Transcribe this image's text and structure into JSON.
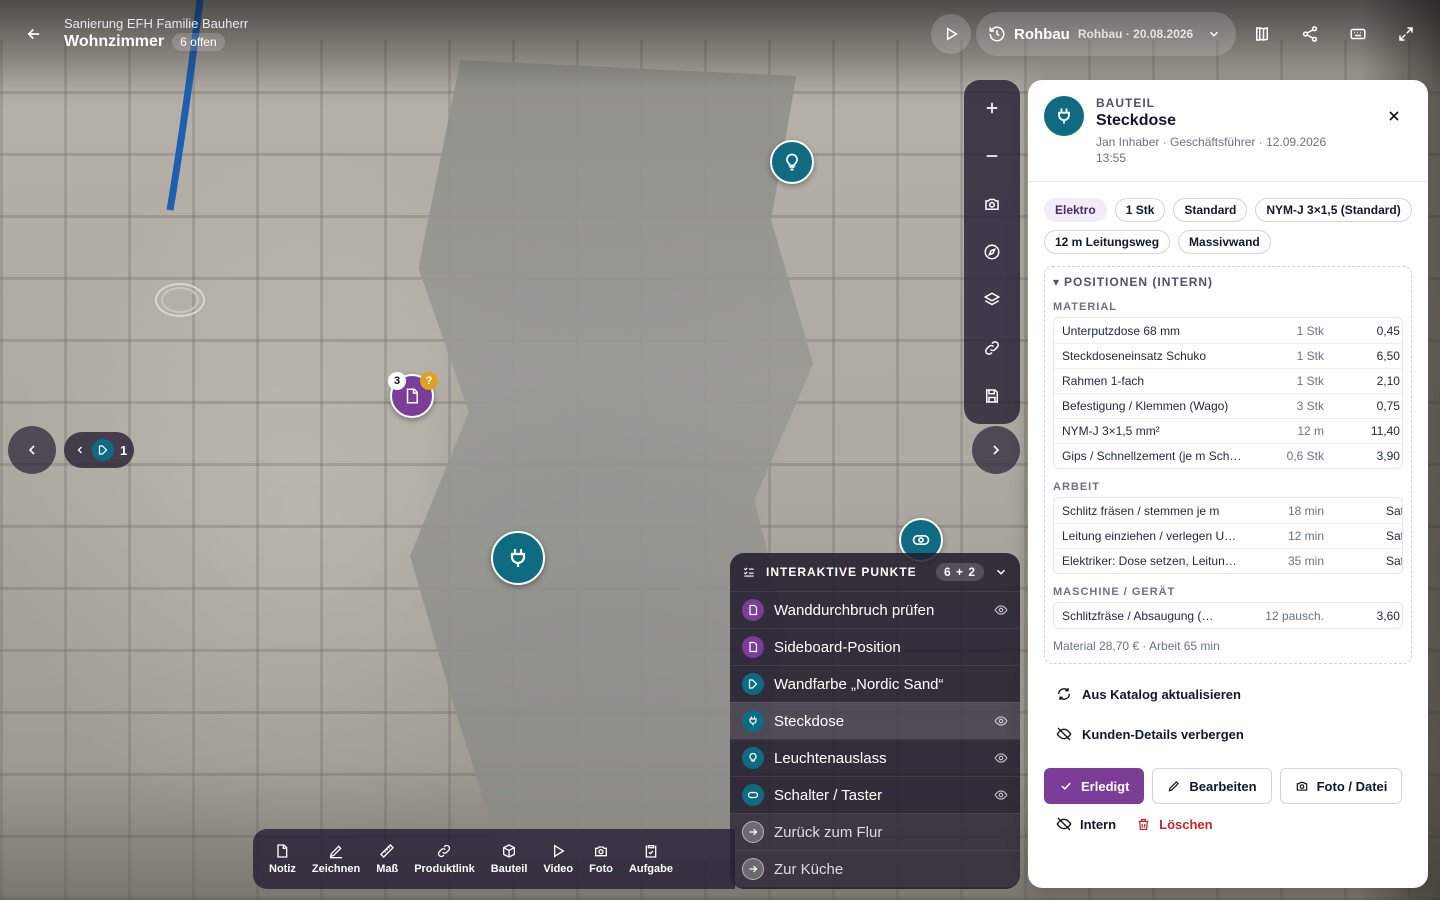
{
  "header": {
    "project": "Sanierung EFH Familie Bauherr",
    "room": "Wohnzimmer",
    "open_badge": "6 offen",
    "phase_name": "Rohbau",
    "phase_sub": "Rohbau · 20.08.2026"
  },
  "group": {
    "count": "1"
  },
  "markers": {
    "doc_badge": "3",
    "doc_question": "?"
  },
  "points": {
    "title": "INTERAKTIVE PUNKTE",
    "count": "6 + 2",
    "items": [
      {
        "label": "Wanddurchbruch prüfen",
        "icon": "document-icon",
        "color": "#7b3d97"
      },
      {
        "label": "Sideboard-Position",
        "icon": "document-icon",
        "color": "#7b3d97"
      },
      {
        "label": "Wandfarbe „Nordic Sand“",
        "icon": "paint-icon",
        "color": "#0f6b82"
      },
      {
        "label": "Steckdose",
        "icon": "plug-icon",
        "color": "#0f6b82"
      },
      {
        "label": "Leuchtenauslass",
        "icon": "bulb-icon",
        "color": "#0f6b82"
      },
      {
        "label": "Schalter / Taster",
        "icon": "switch-icon",
        "color": "#0f6b82"
      },
      {
        "label": "Zurück zum Flur",
        "icon": "arrow-right-icon"
      },
      {
        "label": "Zur Küche",
        "icon": "arrow-right-icon"
      }
    ]
  },
  "bottom_tools": [
    "Notiz",
    "Zeichnen",
    "Maß",
    "Produktlink",
    "Bauteil",
    "Video",
    "Foto",
    "Aufgabe"
  ],
  "detail": {
    "kicker": "BAUTEIL",
    "title": "Steckdose",
    "meta": "Jan Inhaber · Geschäftsführer · 12.09.2026 13:55",
    "chips": [
      "Elektro",
      "1 Stk",
      "Standard",
      "NYM-J 3×1,5 (Standard)",
      "12 m Leitungsweg",
      "Massivwand"
    ],
    "positions_title": "POSITIONEN (INTERN)",
    "material_label": "MATERIAL",
    "material": [
      {
        "name": "Unterputzdose 68 mm",
        "qty": "1 Stk",
        "price": "0,45 €"
      },
      {
        "name": "Steckdoseneinsatz Schuko",
        "qty": "1 Stk",
        "price": "6,50 €"
      },
      {
        "name": "Rahmen 1-fach",
        "qty": "1 Stk",
        "price": "2,10 €"
      },
      {
        "name": "Befestigung / Klemmen (Wago)",
        "qty": "3 Stk",
        "price": "0,75 €"
      },
      {
        "name": "NYM-J 3×1,5 mm²",
        "qty": "12 m",
        "price": "11,40 €"
      },
      {
        "name": "Gips / Schnellzement (je m Sch…",
        "qty": "0,6 Stk",
        "price": "3,90 €"
      }
    ],
    "arbeit_label": "ARBEIT",
    "arbeit": [
      {
        "name": "Schlitz fräsen / stemmen je m",
        "qty": "18 min",
        "price": "Satz"
      },
      {
        "name": "Leitung einziehen / verlegen U…",
        "qty": "12 min",
        "price": "Satz"
      },
      {
        "name": "Elektriker: Dose setzen, Leitun…",
        "qty": "35 min",
        "price": "Satz"
      }
    ],
    "machine_label": "MASCHINE / GERÄT",
    "machine": [
      {
        "name": "Schlitzfräse / Absaugung (…",
        "qty": "12 pausch.",
        "price": "3,60 €"
      }
    ],
    "totals": "Material 28,70 € · Arbeit 65 min",
    "action_catalog": "Aus Katalog aktualisieren",
    "action_hide": "Kunden-Details verbergen",
    "btn_done": "Erledigt",
    "btn_edit": "Bearbeiten",
    "btn_photo": "Foto / Datei",
    "btn_intern": "Intern",
    "btn_delete": "Löschen"
  },
  "colors": {
    "accent_purple": "#7b3d97",
    "accent_teal": "#0f6b82",
    "danger": "#c0262d",
    "warning": "#e0a020"
  }
}
